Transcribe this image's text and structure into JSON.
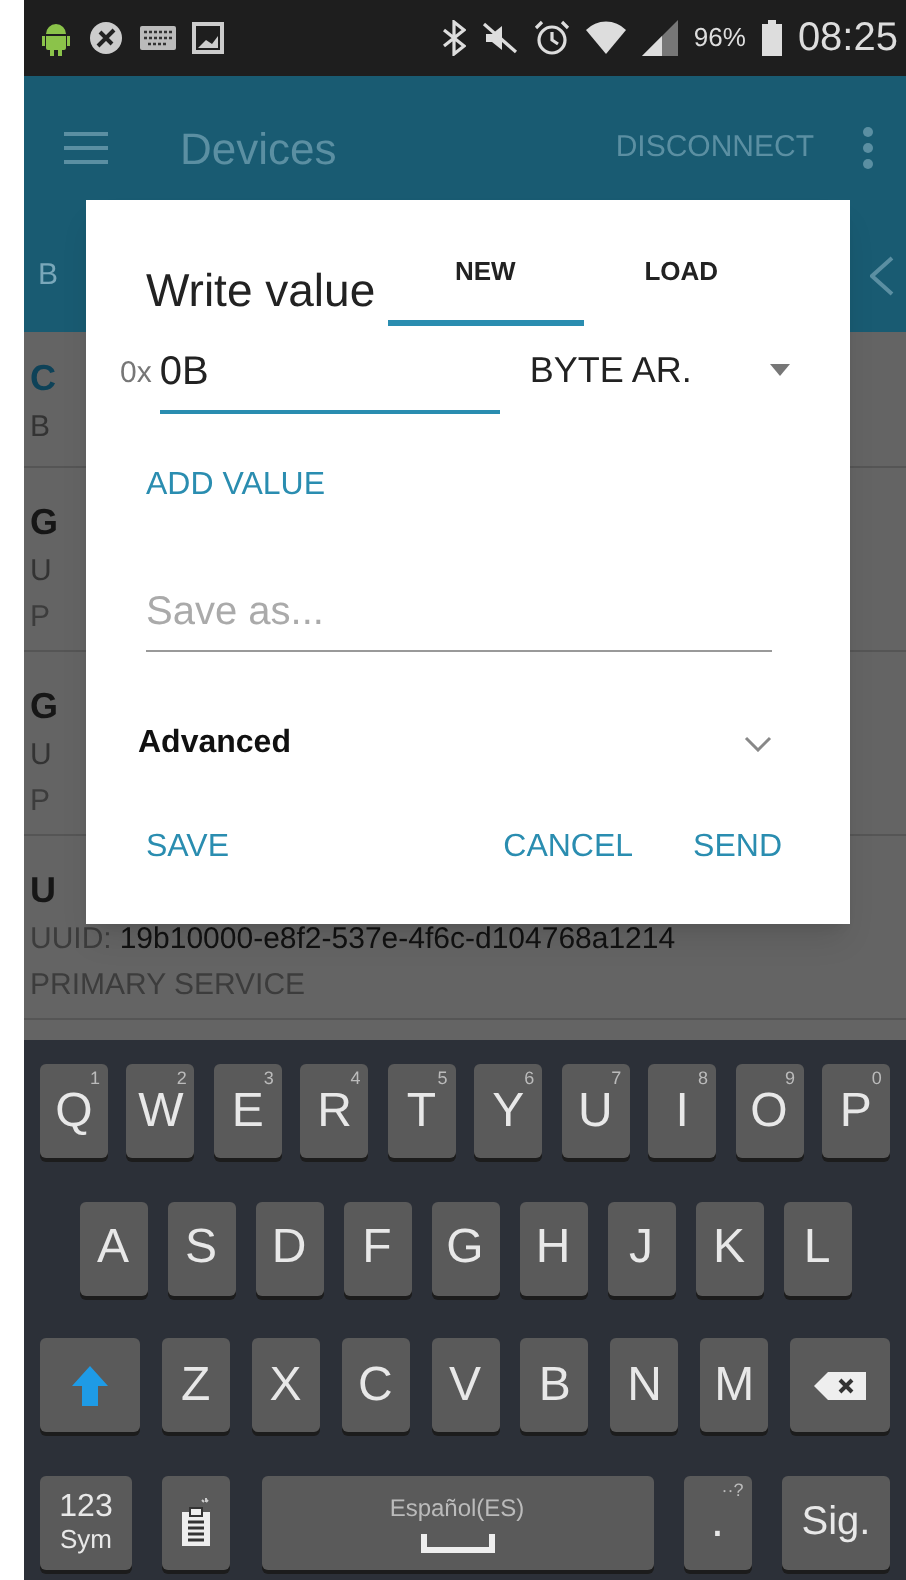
{
  "status_bar": {
    "battery": "96%",
    "time": "08:25"
  },
  "app_bar": {
    "title": "Devices",
    "action": "DISCONNECT"
  },
  "tab_row": {
    "tab_text": "B"
  },
  "list": [
    {
      "title": "C",
      "subtitle": "B"
    },
    {
      "title": "G",
      "subtitle": "U",
      "type": "P"
    },
    {
      "title": "G",
      "subtitle": "U",
      "type": "P"
    },
    {
      "title": "U",
      "uuid_label": "UUID:",
      "uuid": "19b10000-e8f2-537e-4f6c-d104768a1214",
      "type": "PRIMARY SERVICE"
    }
  ],
  "dialog": {
    "title": "Write value",
    "tabs": [
      {
        "label": "NEW",
        "selected": true
      },
      {
        "label": "LOAD",
        "selected": false
      }
    ],
    "prefix": "0x",
    "value": "0B",
    "format": "BYTE AR.",
    "add_value": "ADD VALUE",
    "save_as": {
      "placeholder": "Save as..."
    },
    "advanced": {
      "label": "Advanced",
      "expanded": false
    },
    "buttons": [
      "SAVE",
      "CANCEL",
      "SEND"
    ]
  },
  "keyboard": {
    "rows": [
      {
        "keys": [
          {
            "kind": "letter",
            "label": "Q",
            "hint": "1"
          },
          {
            "kind": "letter",
            "label": "W",
            "hint": "2"
          },
          {
            "kind": "letter",
            "label": "E",
            "hint": "3"
          },
          {
            "kind": "letter",
            "label": "R",
            "hint": "4"
          },
          {
            "kind": "letter",
            "label": "T",
            "hint": "5"
          },
          {
            "kind": "letter",
            "label": "Y",
            "hint": "6"
          },
          {
            "kind": "letter",
            "label": "U",
            "hint": "7"
          },
          {
            "kind": "letter",
            "label": "I",
            "hint": "8"
          },
          {
            "kind": "letter",
            "label": "O",
            "hint": "9"
          },
          {
            "kind": "letter",
            "label": "P",
            "hint": "0"
          }
        ]
      },
      {
        "keys": [
          {
            "kind": "letter",
            "label": "A"
          },
          {
            "kind": "letter",
            "label": "S"
          },
          {
            "kind": "letter",
            "label": "D"
          },
          {
            "kind": "letter",
            "label": "F"
          },
          {
            "kind": "letter",
            "label": "G"
          },
          {
            "kind": "letter",
            "label": "H"
          },
          {
            "kind": "letter",
            "label": "J"
          },
          {
            "kind": "letter",
            "label": "K"
          },
          {
            "kind": "letter",
            "label": "L"
          }
        ]
      },
      {
        "keys": [
          {
            "kind": "shift"
          },
          {
            "kind": "letter",
            "label": "Z"
          },
          {
            "kind": "letter",
            "label": "X"
          },
          {
            "kind": "letter",
            "label": "C"
          },
          {
            "kind": "letter",
            "label": "V"
          },
          {
            "kind": "letter",
            "label": "B"
          },
          {
            "kind": "letter",
            "label": "N"
          },
          {
            "kind": "letter",
            "label": "M"
          },
          {
            "kind": "backspace"
          }
        ]
      },
      {
        "keys": [
          {
            "kind": "sym",
            "label": "123",
            "sublabel": "Sym"
          },
          {
            "kind": "clipboard"
          },
          {
            "kind": "space",
            "label": "Español(ES)"
          },
          {
            "kind": "letter",
            "label": ".",
            "hint": "··?"
          },
          {
            "kind": "next",
            "label": "Sig."
          }
        ]
      }
    ]
  }
}
